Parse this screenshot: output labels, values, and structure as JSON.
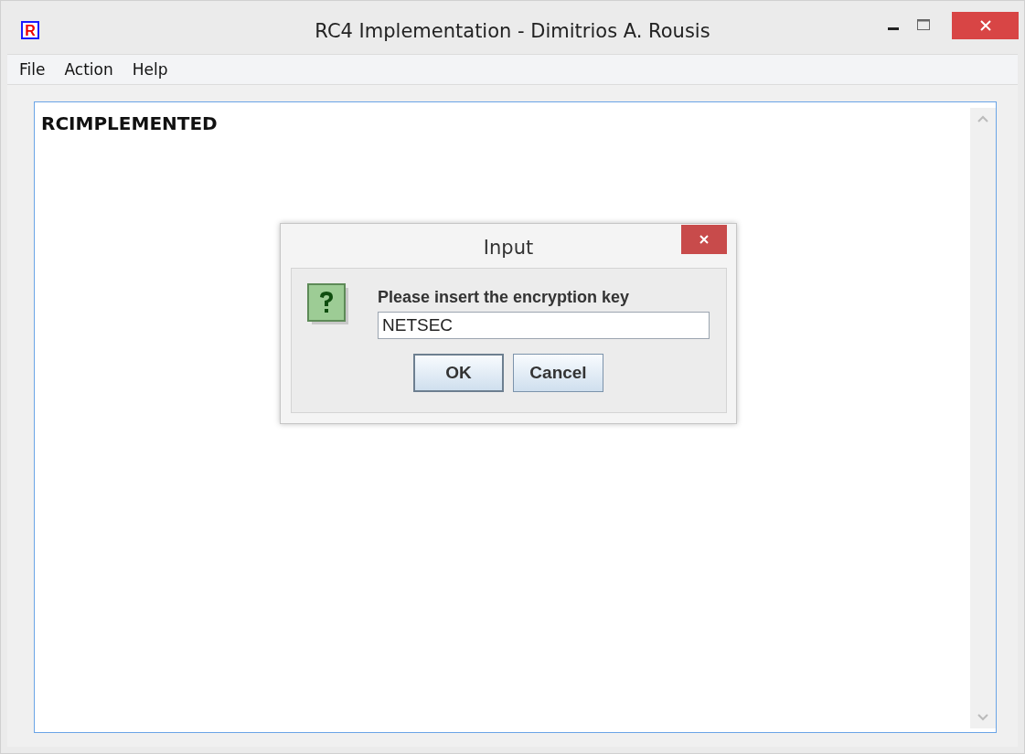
{
  "window": {
    "icon_letter": "R",
    "title": "RC4 Implementation - Dimitrios A. Rousis"
  },
  "menu": [
    "File",
    "Action",
    "Help"
  ],
  "text_area": {
    "value": "RCIMPLEMENTED"
  },
  "dialog": {
    "title": "Input",
    "message": "Please insert the encryption key",
    "field": {
      "value": "NETSEC"
    },
    "buttons": [
      {
        "label": "OK",
        "default": true
      },
      {
        "label": "Cancel",
        "default": false
      }
    ]
  }
}
